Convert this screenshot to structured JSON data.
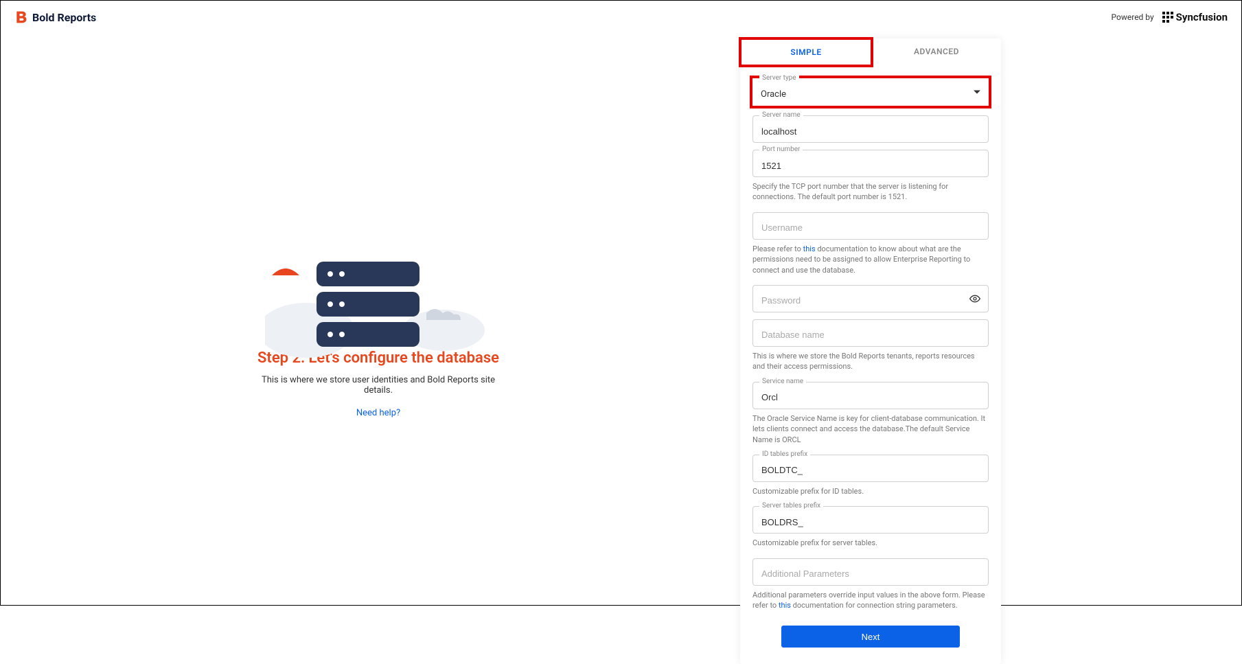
{
  "header": {
    "logo_text": "Bold Reports",
    "powered_by": "Powered by",
    "syncfusion": "Syncfusion"
  },
  "left": {
    "title": "Step 2: Let's configure the database",
    "subtitle": "This is where we store user identities and Bold Reports site details.",
    "help": "Need help?"
  },
  "tabs": {
    "simple": "SIMPLE",
    "advanced": "ADVANCED"
  },
  "form": {
    "server_type": {
      "label": "Server type",
      "value": "Oracle"
    },
    "server_name": {
      "label": "Server name",
      "value": "localhost"
    },
    "port": {
      "label": "Port number",
      "value": "1521",
      "hint": "Specify the TCP port number that the server is listening for connections. The default port number is 1521."
    },
    "username": {
      "placeholder": "Username",
      "hint_pre": "Please refer to ",
      "hint_link": "this",
      "hint_post": " documentation to know about what are the permissions need to be assigned to allow Enterprise Reporting to connect and use the database."
    },
    "password": {
      "placeholder": "Password"
    },
    "dbname": {
      "placeholder": "Database name",
      "hint": "This is where we store the Bold Reports tenants, reports resources and their access permissions."
    },
    "service": {
      "label": "Service name",
      "value": "Orcl",
      "hint": "The Oracle Service Name is key for client-database communication. It lets clients connect and access the database.The default Service Name is ORCL"
    },
    "id_prefix": {
      "label": "ID tables prefix",
      "value": "BOLDTC_",
      "hint": "Customizable prefix for ID tables."
    },
    "server_prefix": {
      "label": "Server tables prefix",
      "value": "BOLDRS_",
      "hint": "Customizable prefix for server tables."
    },
    "additional": {
      "placeholder": "Additional Parameters",
      "hint_pre": "Additional parameters override input values in the above form. Please refer to ",
      "hint_link": "this",
      "hint_post": " documentation for connection string parameters."
    },
    "next": "Next"
  }
}
